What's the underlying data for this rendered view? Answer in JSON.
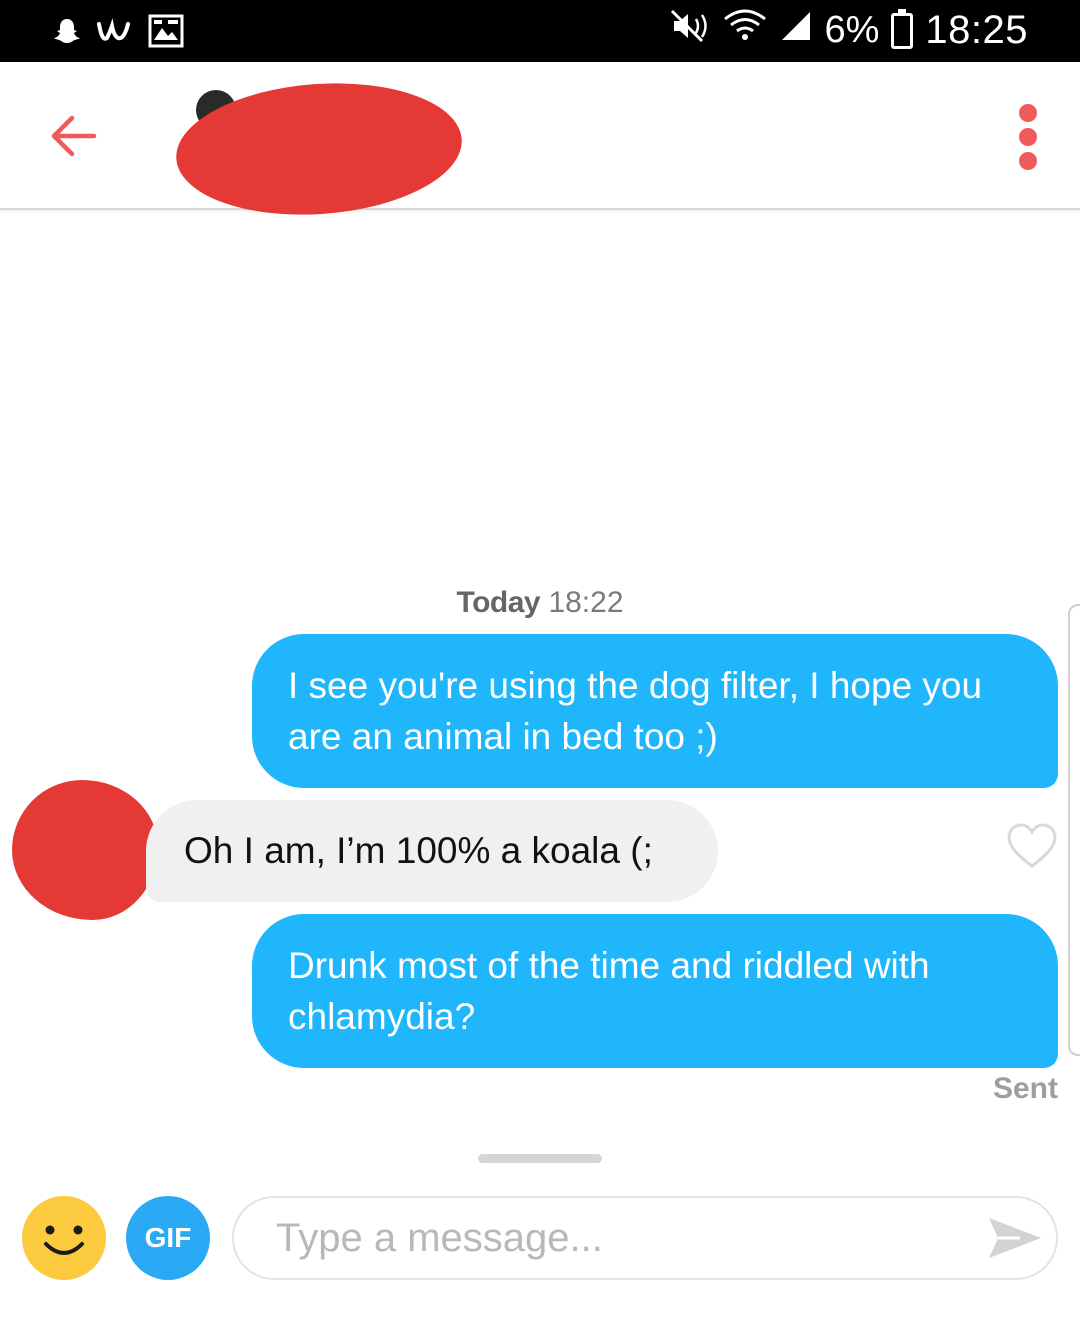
{
  "status_bar": {
    "icons": [
      "snapchat-icon",
      "wish-icon",
      "gallery-icon",
      "mute-icon",
      "wifi-icon",
      "signal-icon",
      "battery-icon"
    ],
    "battery_percent": "6%",
    "clock": "18:25"
  },
  "header": {
    "back_icon": "back-arrow-icon",
    "more_icon": "more-vertical-icon",
    "accent_color": "#f05a5a"
  },
  "chat": {
    "timestamp_day": "Today",
    "timestamp_time": "18:22",
    "messages": [
      {
        "direction": "out",
        "text": "I see you're using the dog filter, I hope you are an animal in bed too ;)"
      },
      {
        "direction": "in",
        "text": "Oh I am, I’m 100% a koala (;"
      },
      {
        "direction": "out",
        "text": "Drunk most of the time and riddled with chlamydia?"
      }
    ],
    "status": "Sent",
    "outgoing_color": "#1fb6fb",
    "incoming_color": "#f0f0f0"
  },
  "composer": {
    "emoji_icon": "smiley-icon",
    "gif_label": "GIF",
    "placeholder": "Type a message...",
    "send_icon": "send-icon"
  }
}
